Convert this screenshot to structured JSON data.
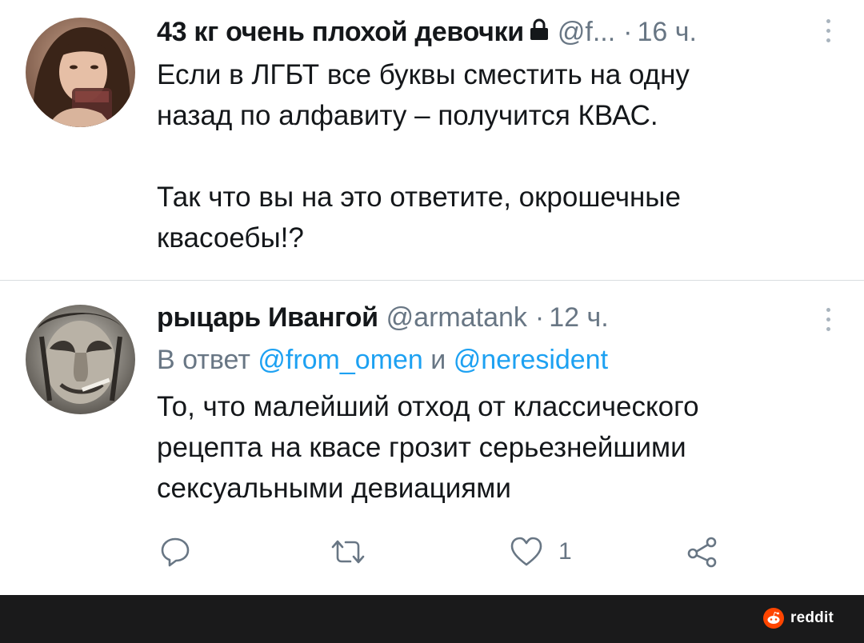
{
  "tweets": [
    {
      "name": "43 кг очень плохой девочки",
      "handle": "@f...",
      "sep": "·",
      "time": "16 ч.",
      "text": "Если в ЛГБТ все буквы сместить на одну\nназад по алфавиту – получится КВАС.\n\nТак что вы на это ответите, окрошечные\nквасоебы!?"
    },
    {
      "name": "рыцарь Ивангой",
      "handle": "@armatank",
      "sep": "·",
      "time": "12 ч.",
      "reply_prefix": "В ответ",
      "reply_mention_1": "@from_omen",
      "reply_join": "и",
      "reply_mention_2": "@neresident",
      "text": "То, что малейший отход от классического\nрецепта на квасе грозит серьезнейшими\nсексуальными девиациями",
      "like_count": "1"
    }
  ],
  "icons": {
    "lock": "lock-icon",
    "more": "more-vertical-icon",
    "reply": "reply-icon",
    "retweet": "retweet-icon",
    "like": "heart-icon",
    "share": "share-icon",
    "reddit": "reddit-logo-icon"
  },
  "colors": {
    "text": "#14171a",
    "secondary": "#687684",
    "link": "#1da1f2",
    "footer": "#1a1a1b",
    "reddit": "#ff4500"
  },
  "footer": {
    "brand": "reddit"
  }
}
